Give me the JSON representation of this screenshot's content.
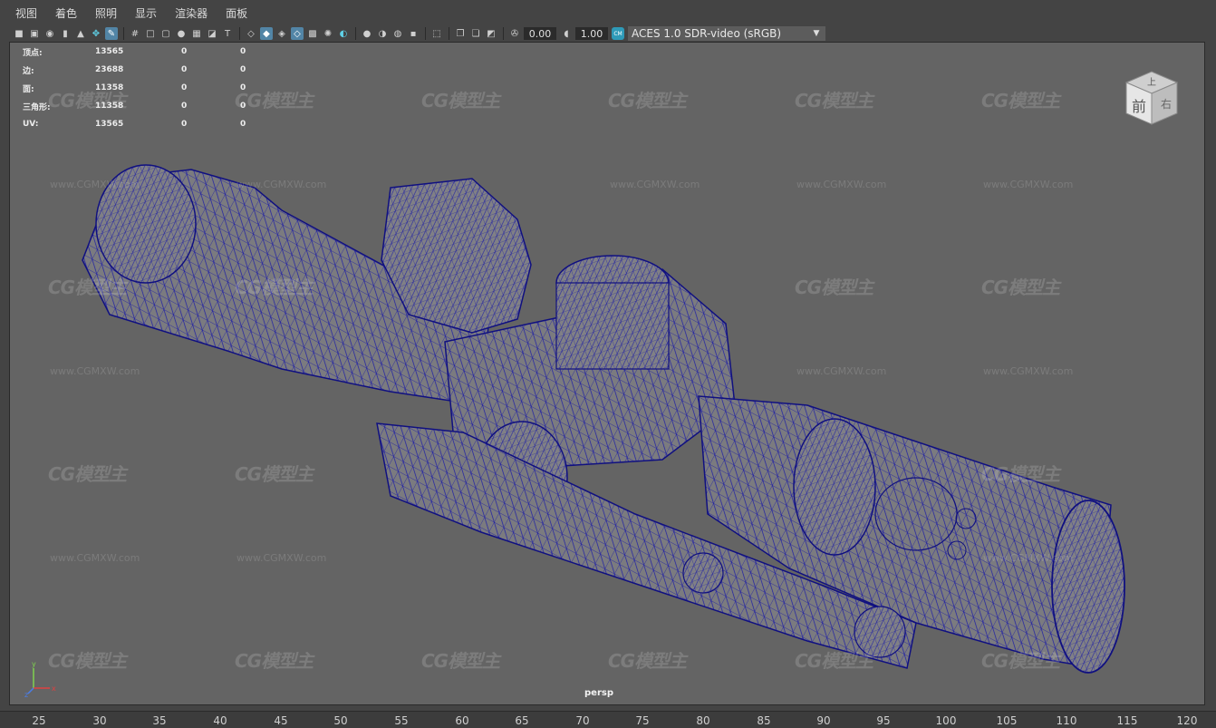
{
  "menu": [
    "视图",
    "着色",
    "照明",
    "显示",
    "渲染器",
    "面板"
  ],
  "toolbar": {
    "icons": [
      "camera-icon",
      "lock-camera-icon",
      "camera-attr-icon",
      "bookmark-icon",
      "image-plane-icon",
      "grease-pencil-icon",
      "2d-pan-icon",
      "grid-icon",
      "film-gate-icon",
      "resolution-gate-icon",
      "gate-mask-icon",
      "field-chart-icon",
      "safe-action-icon",
      "safe-title-icon",
      "wireframe-icon",
      "smooth-shade-icon",
      "shade-wire-icon",
      "wireframe-on-shaded-icon",
      "xray-icon",
      "textures-icon",
      "lights-icon",
      "shadows-icon",
      "ambient-occlusion-icon",
      "motion-blur-icon",
      "anti-alias-icon",
      "depth-of-field-icon",
      "isolate-select-icon",
      "xray-joints-icon",
      "xray-active-icon",
      "backface-icon",
      "exposure-icon",
      "gamma-icon",
      "color-management-icon"
    ],
    "exposure": "0.00",
    "gamma": "1.00",
    "color_space": "ACES 1.0 SDR-video (sRGB)"
  },
  "hud": [
    {
      "label": "顶点:",
      "v1": "13565",
      "v2": "0",
      "v3": "0"
    },
    {
      "label": "边:",
      "v1": "23688",
      "v2": "0",
      "v3": "0"
    },
    {
      "label": "面:",
      "v1": "11358",
      "v2": "0",
      "v3": "0"
    },
    {
      "label": "三角形:",
      "v1": "11358",
      "v2": "0",
      "v3": "0"
    },
    {
      "label": "UV:",
      "v1": "13565",
      "v2": "0",
      "v3": "0"
    }
  ],
  "viewcube": {
    "top": "上",
    "front": "前",
    "right": "右"
  },
  "camera": "persp",
  "axis": {
    "y": "y",
    "x": "x",
    "z": "z"
  },
  "watermark": {
    "logo": "CG模型主",
    "url": "www.CGMXW.com"
  },
  "ruler": [
    "25",
    "30",
    "35",
    "40",
    "45",
    "50",
    "55",
    "60",
    "65",
    "70",
    "75",
    "80",
    "85",
    "90",
    "95",
    "100",
    "105",
    "110",
    "115",
    "120"
  ],
  "colors": {
    "accent": "#5285a6",
    "wire": "#1a1aa0",
    "viewport_bg": "#646464"
  }
}
